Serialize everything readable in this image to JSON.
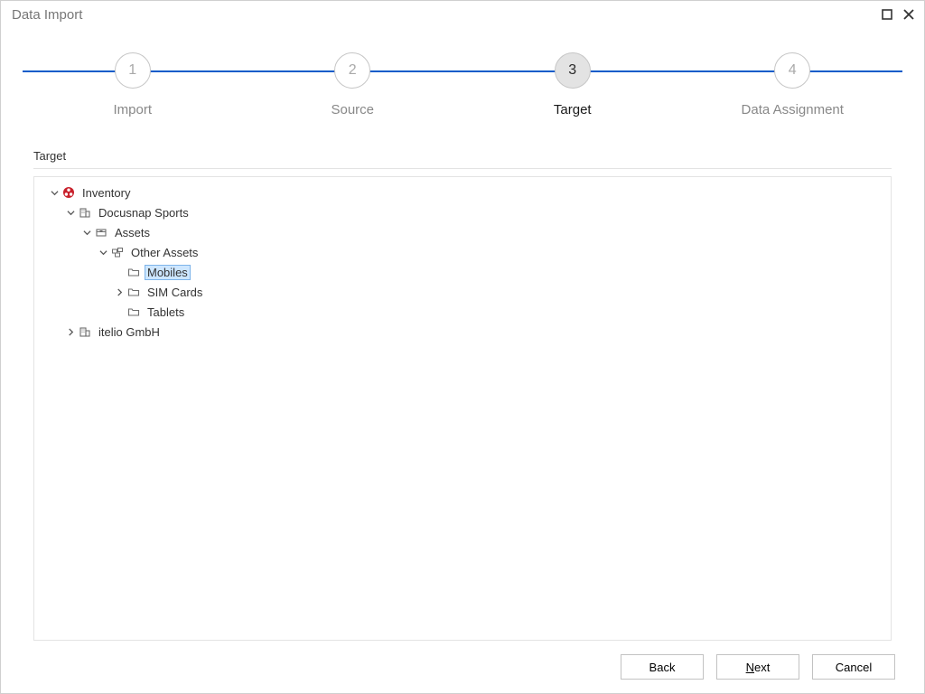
{
  "window": {
    "title": "Data Import"
  },
  "stepper": {
    "steps": [
      {
        "num": "1",
        "label": "Import",
        "pos_pct": 12.5,
        "active": false
      },
      {
        "num": "2",
        "label": "Source",
        "pos_pct": 37.5,
        "active": false
      },
      {
        "num": "3",
        "label": "Target",
        "pos_pct": 62.5,
        "active": true
      },
      {
        "num": "4",
        "label": "Data Assignment",
        "pos_pct": 87.5,
        "active": false
      }
    ]
  },
  "section": {
    "title": "Target"
  },
  "tree": {
    "root": {
      "label": "Inventory",
      "items": {
        "docusnap": {
          "label": "Docusnap Sports"
        },
        "assets": {
          "label": "Assets"
        },
        "other_assets": {
          "label": "Other Assets"
        },
        "mobiles": {
          "label": "Mobiles"
        },
        "sim": {
          "label": "SIM Cards"
        },
        "tablets": {
          "label": "Tablets"
        },
        "itelio": {
          "label": "itelio GmbH"
        }
      }
    }
  },
  "buttons": {
    "back": "Back",
    "next": "Next",
    "cancel": "Cancel"
  },
  "icons": {
    "inventory": "inventory-icon",
    "company": "company-icon",
    "assets": "assets-box-icon",
    "other_assets": "other-assets-icon",
    "folder": "folder-icon"
  }
}
